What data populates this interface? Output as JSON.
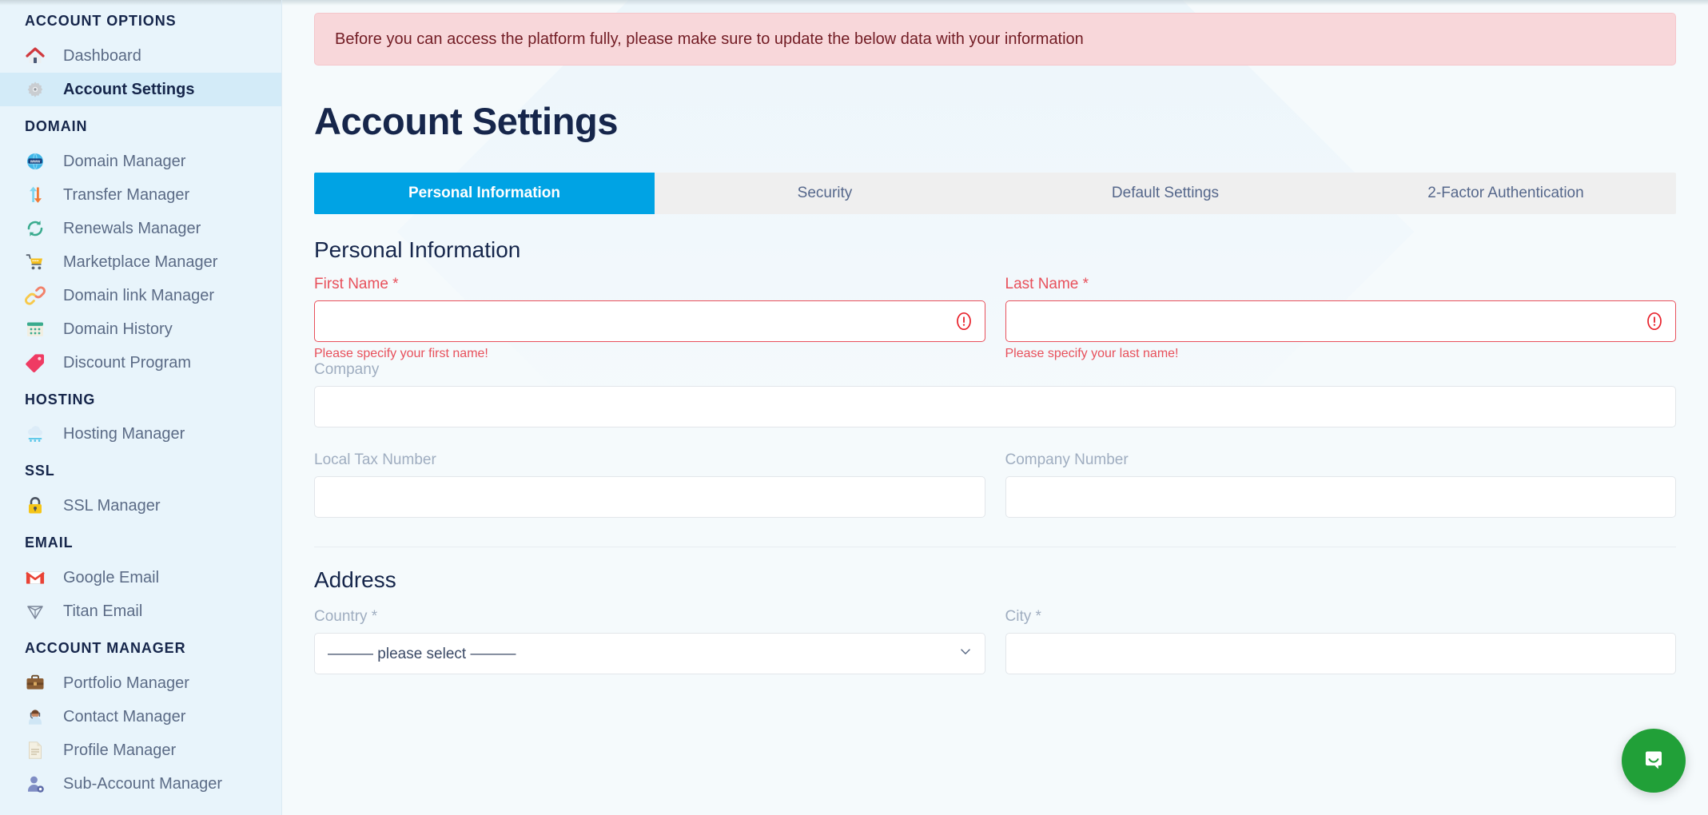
{
  "sidebar": {
    "groups": [
      {
        "title": "ACCOUNT OPTIONS",
        "items": [
          {
            "label": "Dashboard",
            "icon": "house-icon",
            "active": false
          },
          {
            "label": "Account Settings",
            "icon": "gear-icon",
            "active": true
          }
        ]
      },
      {
        "title": "DOMAIN",
        "items": [
          {
            "label": "Domain Manager",
            "icon": "globe-www-icon",
            "active": false
          },
          {
            "label": "Transfer Manager",
            "icon": "transfer-arrows-icon",
            "active": false
          },
          {
            "label": "Renewals Manager",
            "icon": "refresh-cycle-icon",
            "active": false
          },
          {
            "label": "Marketplace Manager",
            "icon": "shopping-cart-icon",
            "active": false
          },
          {
            "label": "Domain link Manager",
            "icon": "chain-link-icon",
            "active": false
          },
          {
            "label": "Domain History",
            "icon": "calendar-icon",
            "active": false
          },
          {
            "label": "Discount Program",
            "icon": "price-tag-icon",
            "active": false
          }
        ]
      },
      {
        "title": "HOSTING",
        "items": [
          {
            "label": "Hosting Manager",
            "icon": "cloud-server-icon",
            "active": false
          }
        ]
      },
      {
        "title": "SSL",
        "items": [
          {
            "label": "SSL Manager",
            "icon": "padlock-icon",
            "active": false
          }
        ]
      },
      {
        "title": "EMAIL",
        "items": [
          {
            "label": "Google Email",
            "icon": "gmail-m-icon",
            "active": false
          },
          {
            "label": "Titan Email",
            "icon": "titan-prism-icon",
            "active": false
          }
        ]
      },
      {
        "title": "ACCOUNT MANAGER",
        "items": [
          {
            "label": "Portfolio Manager",
            "icon": "briefcase-icon",
            "active": false
          },
          {
            "label": "Contact Manager",
            "icon": "headset-person-icon",
            "active": false
          },
          {
            "label": "Profile Manager",
            "icon": "document-page-icon",
            "active": false
          },
          {
            "label": "Sub-Account Manager",
            "icon": "person-gear-icon",
            "active": false
          }
        ]
      }
    ]
  },
  "alert": {
    "message": "Before you can access the platform fully, please make sure to update the below data with your information"
  },
  "page": {
    "title": "Account Settings"
  },
  "tabs": [
    {
      "label": "Personal Information",
      "active": true
    },
    {
      "label": "Security",
      "active": false
    },
    {
      "label": "Default Settings",
      "active": false
    },
    {
      "label": "2-Factor Authentication",
      "active": false
    }
  ],
  "personal_information": {
    "heading": "Personal Information",
    "first_name": {
      "label": "First Name *",
      "value": "",
      "placeholder": "",
      "error": "Please specify your first name!"
    },
    "last_name": {
      "label": "Last Name *",
      "value": "",
      "placeholder": "",
      "error": "Please specify your last name!"
    },
    "company": {
      "label": "Company",
      "value": "",
      "placeholder": ""
    },
    "local_tax_number": {
      "label": "Local Tax Number",
      "value": "",
      "placeholder": ""
    },
    "company_number": {
      "label": "Company Number",
      "value": "",
      "placeholder": ""
    }
  },
  "address": {
    "heading": "Address",
    "country": {
      "label": "Country *",
      "selected": "——— please select ———"
    },
    "city": {
      "label": "City *",
      "value": "",
      "placeholder": ""
    }
  },
  "chat": {
    "label": "Open chat"
  },
  "colors": {
    "accent": "#00a3e4",
    "sidebar_bg": "#e8f4fb",
    "sidebar_active": "#d3ebf8",
    "main_bg": "#f5fafc",
    "alert_bg": "#f8d7da",
    "alert_text": "#721c24",
    "error": "#e8505b",
    "heading": "#16264b",
    "label": "#9fadc0",
    "chat_green": "#21a038"
  }
}
